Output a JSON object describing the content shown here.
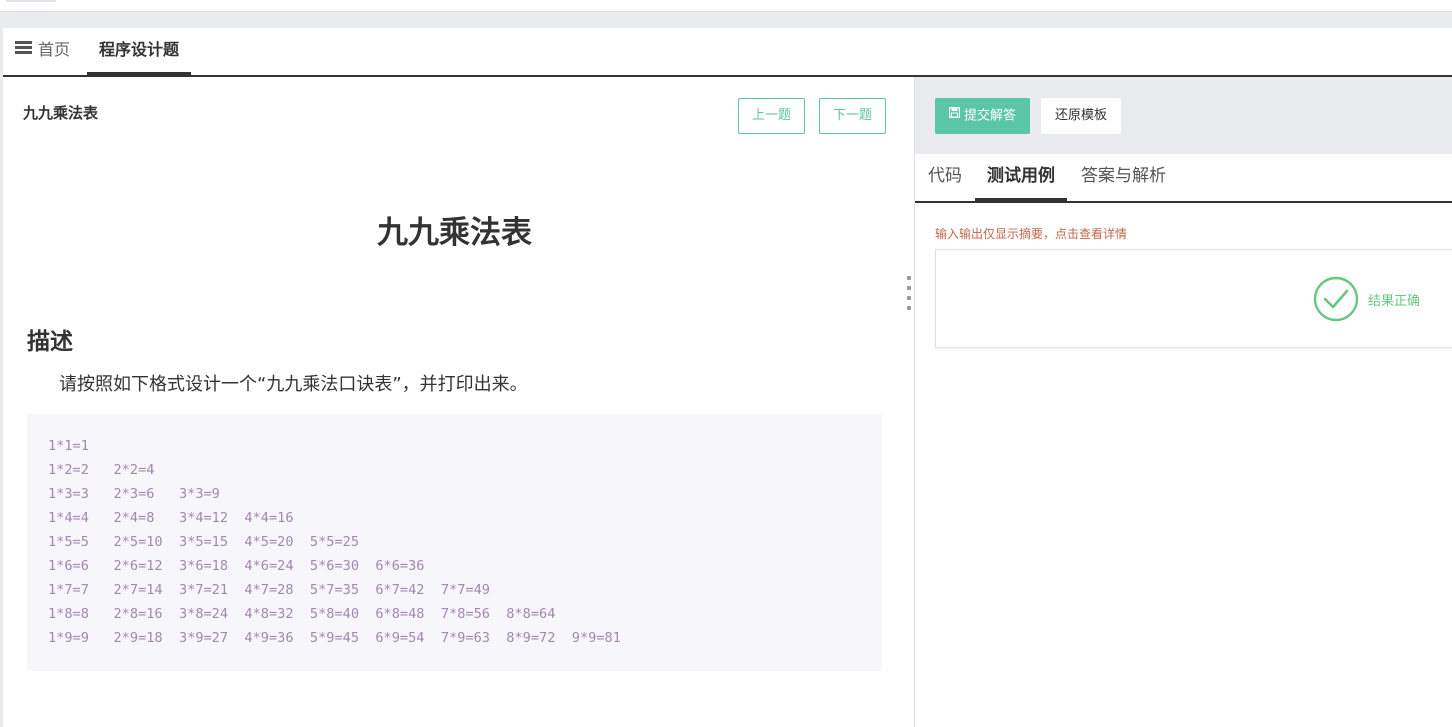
{
  "tabs": {
    "home_label": "首页",
    "active_label": "程序设计题"
  },
  "problem": {
    "header_title": "九九乘法表",
    "prev_label": "上一题",
    "next_label": "下一题",
    "title": "九九乘法表",
    "desc_heading": "描述",
    "desc_text": "请按照如下格式设计一个“九九乘法口诀表”，并打印出来。",
    "code_lines": [
      "1*1=1",
      "1*2=2   2*2=4",
      "1*3=3   2*3=6   3*3=9",
      "1*4=4   2*4=8   3*4=12  4*4=16",
      "1*5=5   2*5=10  3*5=15  4*5=20  5*5=25",
      "1*6=6   2*6=12  3*6=18  4*6=24  5*6=30  6*6=36",
      "1*7=7   2*7=14  3*7=21  4*7=28  5*7=35  6*7=42  7*7=49",
      "1*8=8   2*8=16  3*8=24  4*8=32  5*8=40  6*8=48  7*8=56  8*8=64",
      "1*9=9   2*9=18  3*9=27  4*9=36  5*9=45  6*9=54  7*9=63  8*9=72  9*9=81"
    ]
  },
  "editor": {
    "submit_label": "提交解答",
    "restore_label": "还原模板",
    "tabs": [
      "代码",
      "测试用例",
      "答案与解析"
    ],
    "note": "输入输出仅显示摘要，点击查看详情",
    "result_text": "结果正确"
  },
  "colors": {
    "accent": "#5bc5a7",
    "success": "#67c77f",
    "note": "#c0684c",
    "code_text": "#a387ae"
  }
}
